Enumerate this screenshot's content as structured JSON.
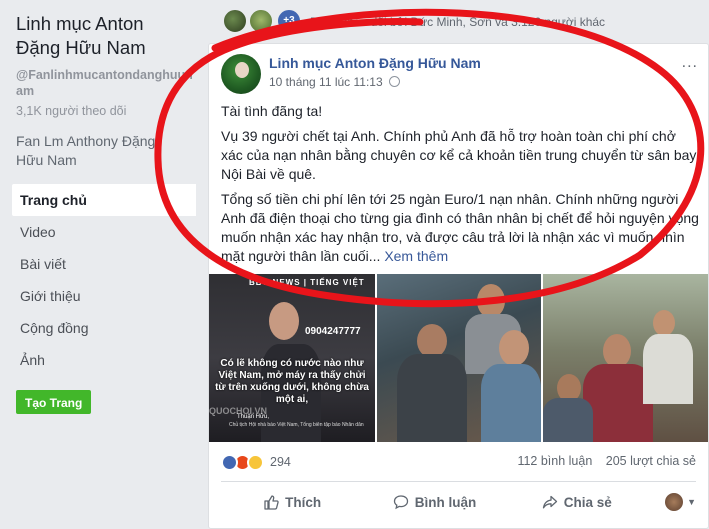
{
  "sidebar": {
    "page_name": "Linh mục Anton Đặng Hữu Nam",
    "handle": "@Fanlinhmucantondanghuunam",
    "followers": "3,1K người theo dõi",
    "category": "Fan Lm Anthony Đặng Hữu Nam",
    "nav": [
      {
        "label": "Trang chủ",
        "active": true
      },
      {
        "label": "Video"
      },
      {
        "label": "Bài viết"
      },
      {
        "label": "Giới thiệu"
      },
      {
        "label": "Cộng đồng"
      },
      {
        "label": "Ảnh"
      }
    ],
    "create_page_label": "Tạo Trang",
    "accent_color": "#42b72a"
  },
  "followed_bar": {
    "more_badge": "+3",
    "text": "Được theo dõi bởi Đức Minh, Sơn và 3.120 người khác"
  },
  "post": {
    "author": "Linh mục Anton Đặng Hữu Nam",
    "timestamp": "10 tháng 11 lúc 11:13",
    "privacy_icon": "globe-icon",
    "menu_label": "...",
    "paragraphs": [
      "Tài tình đãng ta!",
      "Vụ 39 người chết tại Anh. Chính phủ Anh đã hỗ trợ hoàn toàn chi phí chở xác của nạn nhân bằng chuyên cơ kể cả khoản tiền trung chuyển từ sân bay Nội Bài về quê.",
      "Tổng số tiền chi phí lên tới 25 ngàn Euro/1 nạn nhân. Chính những người Anh đã điện thoại cho từng gia đình có thân nhân bị chết để hỏi nguyện vọng muốn nhận xác hay nhận tro, và được câu trả lời là nhận xác vì muốn nhìn mặt người thân lần cuối..."
    ],
    "see_more": "Xem thêm",
    "photo1": {
      "brand": "BBC NEWS | TIẾNG VIỆT",
      "phone": "0904247777",
      "quote": "Có lẽ không có nước nào như Việt Nam, mở máy ra thấy chửi từ trên xuống dưới, không chừa một ai,",
      "watermark": "QUOCHOI.VN",
      "caption_name": "Thuận Hữu,",
      "caption_sub": "Chủ tịch Hội nhà báo Việt Nam, Tổng biên tập báo Nhân dân"
    },
    "reaction_count": "294",
    "comments": "112 bình luận",
    "shares": "205 lượt chia sẻ",
    "actions": {
      "like": "Thích",
      "comment": "Bình luận",
      "share": "Chia sẻ"
    },
    "link_color": "#385898",
    "annotation_color": "#e8141a"
  }
}
